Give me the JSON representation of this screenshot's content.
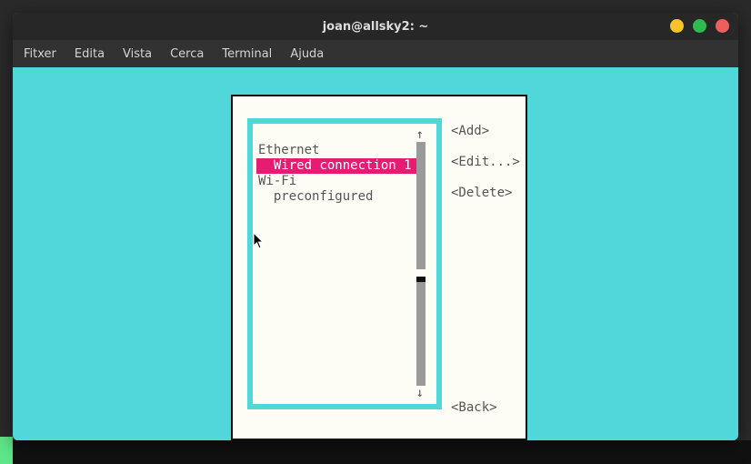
{
  "window": {
    "title": "joan@allsky2: ~"
  },
  "menubar": {
    "items": [
      "Fitxer",
      "Edita",
      "Vista",
      "Cerca",
      "Terminal",
      "Ajuda"
    ]
  },
  "dialog": {
    "list": {
      "group1": "Ethernet",
      "item1": "  Wired connection 1",
      "group2": "Wi-Fi",
      "item2": "  preconfigured"
    },
    "arrows": {
      "up": "↑",
      "down": "↓"
    },
    "actions": {
      "add": "<Add>",
      "edit": "<Edit...>",
      "delete": "<Delete>",
      "back": "<Back>"
    }
  }
}
